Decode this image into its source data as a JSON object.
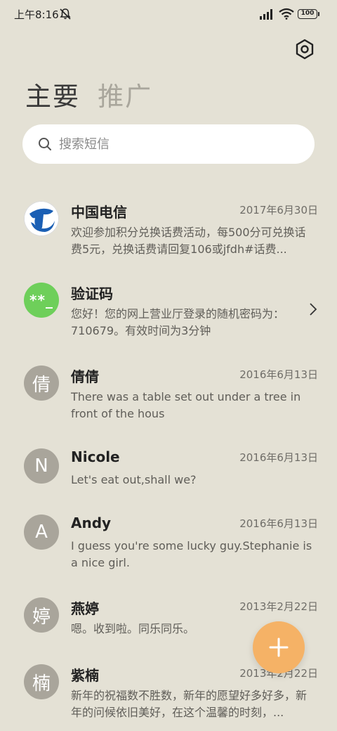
{
  "status": {
    "time": "上午8:16",
    "battery": "100"
  },
  "tabs": [
    {
      "label": "主要"
    },
    {
      "label": "推广"
    }
  ],
  "search": {
    "placeholder": "搜索短信"
  },
  "messages": [
    {
      "name": "中国电信",
      "date": "2017年6月30日",
      "preview": "欢迎参加积分兑换话费活动，每500分可兑换话费5元，兑换话费请回复106或jfdh#话费...",
      "avatar": ""
    },
    {
      "name": "验证码",
      "date": "",
      "preview": "您好！您的网上营业厅登录的随机密码为：710679。有效时间为3分钟",
      "avatar": "**_"
    },
    {
      "name": "倩倩",
      "date": "2016年6月13日",
      "preview": "There was a table set out under a tree in front of the hous",
      "avatar": "倩"
    },
    {
      "name": "Nicole",
      "date": "2016年6月13日",
      "preview": "Let's eat out,shall we?",
      "avatar": "N"
    },
    {
      "name": "Andy",
      "date": "2016年6月13日",
      "preview": "I guess you're some lucky guy.Stephanie is a nice girl.",
      "avatar": "A"
    },
    {
      "name": "燕婷",
      "date": "2013年2月22日",
      "preview": "嗯。收到啦。同乐同乐。",
      "avatar": "婷"
    },
    {
      "name": "紫楠",
      "date": "2013年2月22日",
      "preview": "新年的祝福数不胜数，新年的愿望好多好多，新年的问候依旧美好，在这个温馨的时刻，...",
      "avatar": "楠"
    }
  ],
  "colors": {
    "background": "#e4e1d5",
    "fab": "#f5b266",
    "avatar_gray": "#a9a59b",
    "avatar_green": "#6ecf5a",
    "telecom_blue": "#1a5fb4"
  },
  "icons": [
    "mute-icon",
    "signal-icon",
    "wifi-icon",
    "settings-icon",
    "search-icon",
    "chevron-right-icon",
    "plus-icon",
    "china-telecom-logo"
  ]
}
